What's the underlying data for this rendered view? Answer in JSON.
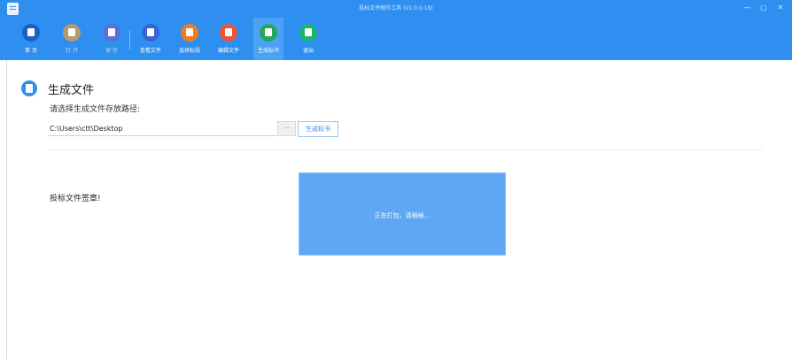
{
  "window": {
    "title": "投标文件制作工具 (V1.0.0.19)",
    "controls": {
      "minimize": "—",
      "maximize": "▢",
      "close": "✕"
    }
  },
  "toolbar": {
    "items": [
      {
        "label": "首 页",
        "icon": "home-icon",
        "color": "#1e5fc7"
      },
      {
        "label": "打 开",
        "icon": "folder-icon",
        "color": "#b39b6e"
      },
      {
        "label": "保 存",
        "icon": "save-icon",
        "color": "#5a6fd8"
      },
      {
        "label": "查看文件",
        "icon": "file-view-icon",
        "color": "#3b63d6"
      },
      {
        "label": "选择标段",
        "icon": "grid-icon",
        "color": "#f07c1e"
      },
      {
        "label": "编辑文件",
        "icon": "edit-icon",
        "color": "#e8563c"
      },
      {
        "label": "生成标书",
        "icon": "generate-icon",
        "color": "#23a85a"
      },
      {
        "label": "退出",
        "icon": "exit-icon",
        "color": "#1bb56e"
      }
    ]
  },
  "section": {
    "title": "生成文件",
    "icon": "document-icon"
  },
  "path": {
    "label": "请选择生成文件存放路径:",
    "value": "C:\\Users\\ctt\\Desktop",
    "browse_label": "···",
    "generate_label": "生成标书"
  },
  "sign": {
    "label": "投标文件签章!"
  },
  "progress": {
    "text": "正在打包，请稍候..."
  },
  "colors": {
    "primary": "#2f8ff0",
    "progress_bg": "#5ea7f5"
  }
}
